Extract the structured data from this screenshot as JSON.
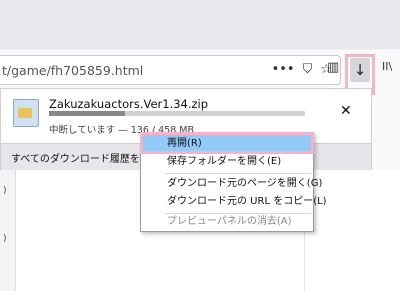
{
  "url_bar": {
    "text": "t/game/fh705859.html"
  },
  "toolbar": {
    "more_icon": "•••",
    "pocket_icon": "⛉",
    "bookmark_icon": "☆",
    "library_icon": "▥",
    "download_icon": "↓",
    "overflow_text": "II\\"
  },
  "download_panel": {
    "file_name": "Zakuzakuactors.Ver1.34.zip",
    "status": "中断しています — 136 / 458 MB",
    "progress_fraction": 0.297,
    "close_icon": "✕",
    "footer_label": "すべてのダウンロード履歴を表示(S)"
  },
  "context_menu": {
    "items": [
      {
        "label": "再開(R)"
      },
      {
        "label": "保存フォルダーを開く(E)"
      },
      {
        "label": "ダウンロード元のページを開く(G)"
      },
      {
        "label": "ダウンロード元の URL をコピー(L)"
      },
      {
        "label": "プレビューパネルの消去(A)"
      }
    ]
  },
  "page_side": {
    "marks": [
      ")",
      ")"
    ]
  },
  "colors": {
    "highlight": "#f1b5c8",
    "menu_active": "#91c9f7"
  }
}
